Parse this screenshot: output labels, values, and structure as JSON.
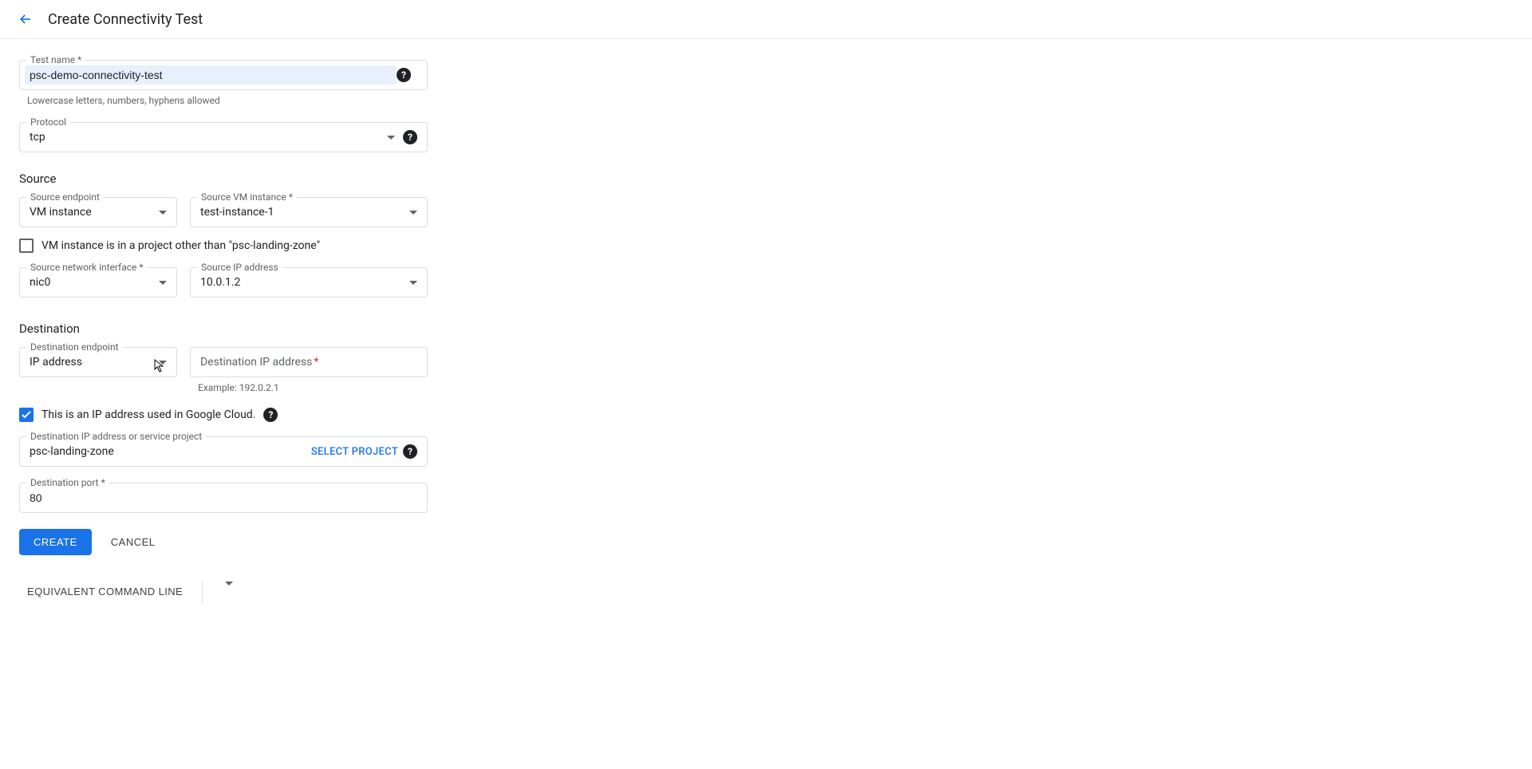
{
  "header": {
    "title": "Create Connectivity Test"
  },
  "testName": {
    "label": "Test name *",
    "value": "psc-demo-connectivity-test",
    "hint": "Lowercase letters, numbers, hyphens allowed"
  },
  "protocol": {
    "label": "Protocol",
    "value": "tcp"
  },
  "source": {
    "heading": "Source",
    "endpoint": {
      "label": "Source endpoint",
      "value": "VM instance"
    },
    "vmInstance": {
      "label": "Source VM instance *",
      "value": "test-instance-1"
    },
    "otherProjectCheckbox": "VM instance is in a project other than \"psc-landing-zone\"",
    "nic": {
      "label": "Source network interface *",
      "value": "nic0"
    },
    "ip": {
      "label": "Source IP address",
      "value": "10.0.1.2"
    }
  },
  "destination": {
    "heading": "Destination",
    "endpoint": {
      "label": "Destination endpoint",
      "value": "IP address"
    },
    "ipField": {
      "placeholder": "Destination IP address",
      "hint": "Example: 192.0.2.1"
    },
    "gcpIpCheckbox": "This is an IP address used in Google Cloud.",
    "project": {
      "label": "Destination IP address or service project",
      "value": "psc-landing-zone",
      "selectLabel": "SELECT PROJECT"
    },
    "port": {
      "label": "Destination port *",
      "value": "80"
    }
  },
  "actions": {
    "create": "CREATE",
    "cancel": "CANCEL",
    "equivalent": "EQUIVALENT COMMAND LINE"
  }
}
